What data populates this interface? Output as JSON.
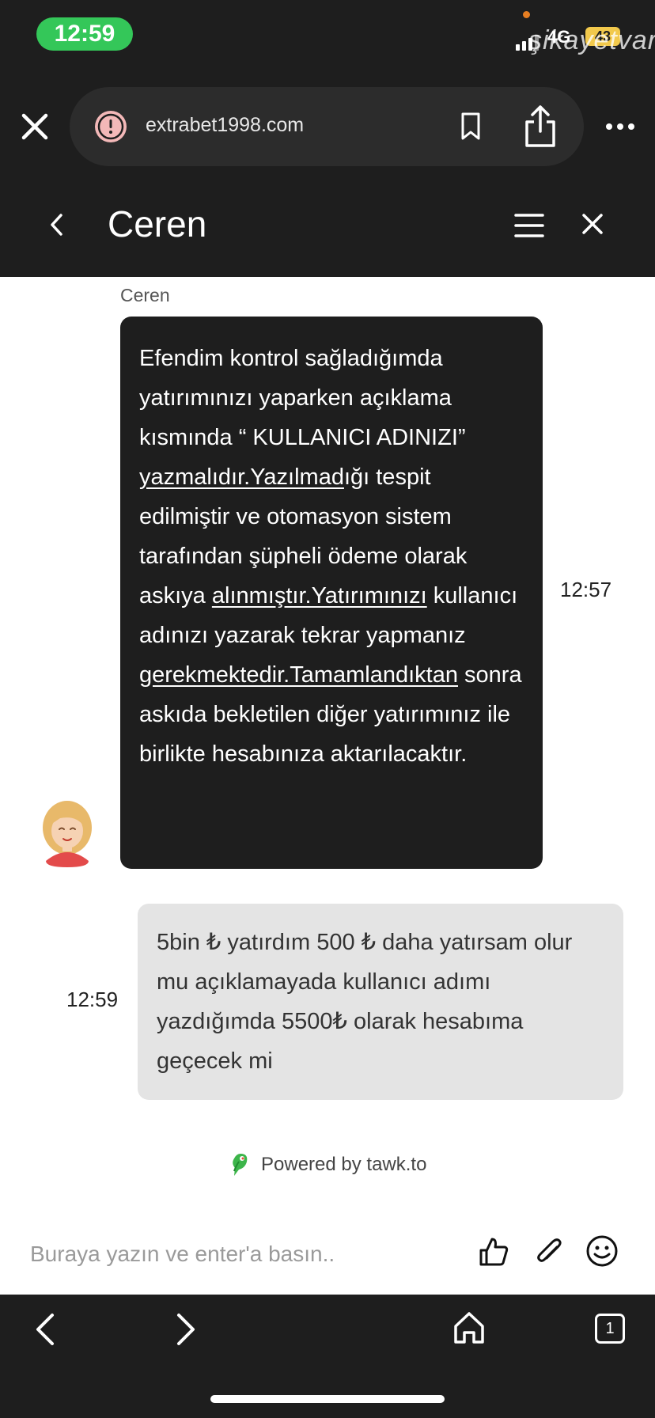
{
  "status_bar": {
    "time": "12:59",
    "network": "4G",
    "battery": "43",
    "watermark": "şikayetvar"
  },
  "browser": {
    "url": "extrabet1998.com",
    "icons": [
      "close-icon",
      "warning-icon",
      "bookmark-icon",
      "share-icon",
      "more-icon"
    ]
  },
  "chat_header": {
    "title": "Ceren",
    "icons": [
      "chevron-left-icon",
      "menu-icon",
      "close-icon"
    ]
  },
  "messages": [
    {
      "sender": "Ceren",
      "time": "12:57",
      "text_parts": [
        "Efendim kontrol sağladığımda yatırımınızı yaparken açıklama kısmında “ KULLANICI ADINIZI” ",
        "yazmalıdır.Yazılmad",
        "ığı tespit edilmiştir ve otomasyon sistem tarafından şüpheli ödeme olarak askıya ",
        "alınmıştır.Yatırımınızı",
        " kullanıcı adınızı yazarak tekrar yapmanız ",
        "gerekmektedir.Tamamlandıktan",
        " sonra askıda bekletilen diğer yatırımınız ile birlikte hesabınıza aktarılacaktır."
      ]
    },
    {
      "sender": "user",
      "time": "12:59",
      "text": "5bin ₺ yatırdım 500 ₺ daha yatırsam olur mu açıklamayada kullanıcı adımı yazdığımda 5500₺ olarak hesabıma geçecek mi"
    }
  ],
  "footer": {
    "powered_by": "Powered by tawk.to"
  },
  "composer": {
    "placeholder": "Buraya yazın ve enter'a basın..",
    "value": ""
  },
  "bottom_nav": {
    "tab_count": "1",
    "icons": [
      "back-icon",
      "forward-icon",
      "home-icon",
      "tabs-icon"
    ]
  },
  "colors": {
    "dark_bg": "#1e1e1e",
    "time_pill": "#34c759",
    "user_bubble": "#e4e4e4",
    "agent_bubble": "#1e1e1e"
  }
}
